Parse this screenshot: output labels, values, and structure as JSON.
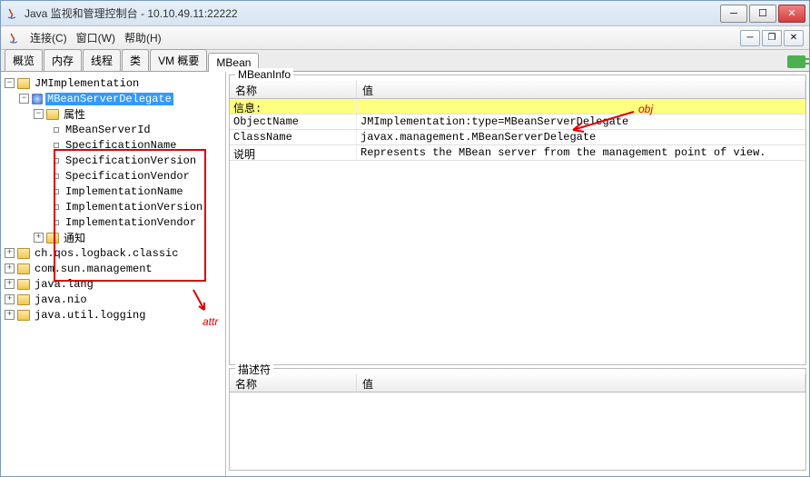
{
  "titlebar": {
    "title": "Java 监视和管理控制台 - 10.10.49.11:22222"
  },
  "menubar": {
    "connect": "连接(C)",
    "window": "窗口(W)",
    "help": "帮助(H)"
  },
  "tabs": {
    "t0": "概览",
    "t1": "内存",
    "t2": "线程",
    "t3": "类",
    "t4": "VM 概要",
    "t5": "MBean"
  },
  "tree": {
    "root0": "JMImplementation",
    "delegate": "MBeanServerDelegate",
    "attrs_label": "属性",
    "attrs": {
      "a0": "MBeanServerId",
      "a1": "SpecificationName",
      "a2": "SpecificationVersion",
      "a3": "SpecificationVendor",
      "a4": "ImplementationName",
      "a5": "ImplementationVersion",
      "a6": "ImplementationVendor"
    },
    "notif": "通知",
    "p1": "ch.qos.logback.classic",
    "p2": "com.sun.management",
    "p3": "java.lang",
    "p4": "java.nio",
    "p5": "java.util.logging"
  },
  "mbeaninfo": {
    "legend": "MBeanInfo",
    "col_name": "名称",
    "col_value": "值",
    "rows": {
      "r_info": "信息:",
      "r_on_k": "ObjectName",
      "r_on_v": "JMImplementation:type=MBeanServerDelegate",
      "r_cn_k": "ClassName",
      "r_cn_v": "javax.management.MBeanServerDelegate",
      "r_desc_k": "说明",
      "r_desc_v": "Represents  the MBean server from the management point of view."
    }
  },
  "descriptor": {
    "legend": "描述符",
    "col_name": "名称",
    "col_value": "值"
  },
  "annotations": {
    "attr": "attr",
    "obj": "obj"
  }
}
